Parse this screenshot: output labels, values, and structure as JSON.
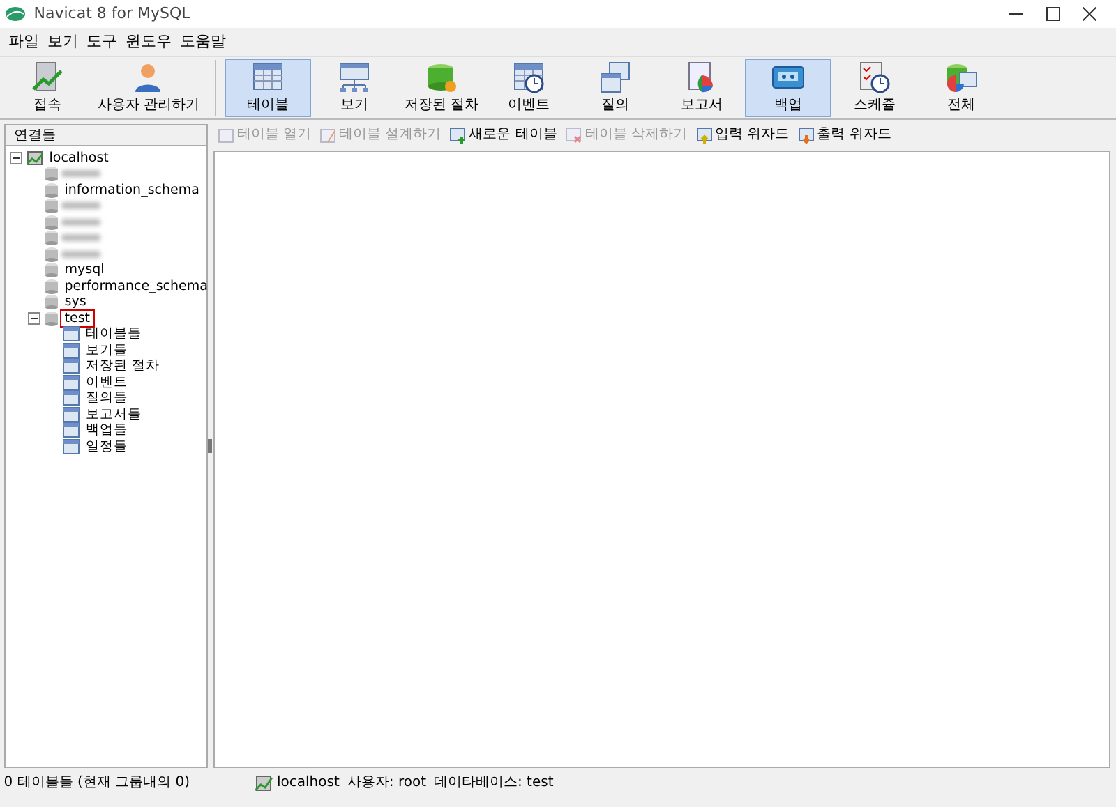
{
  "window": {
    "title": "Navicat 8 for MySQL"
  },
  "menu": [
    {
      "label": "파일"
    },
    {
      "label": "보기"
    },
    {
      "label": "도구"
    },
    {
      "label": "윈도우"
    },
    {
      "label": "도움말"
    }
  ],
  "toolbar": [
    {
      "label": "접속",
      "selected": false,
      "separator_after": false
    },
    {
      "label": "사용자 관리하기",
      "selected": false,
      "separator_after": true
    },
    {
      "label": "테이블",
      "selected": true,
      "separator_after": false
    },
    {
      "label": "보기",
      "selected": false,
      "separator_after": false
    },
    {
      "label": "저장된 절차",
      "selected": false,
      "separator_after": false
    },
    {
      "label": "이벤트",
      "selected": false,
      "separator_after": false
    },
    {
      "label": "질의",
      "selected": false,
      "separator_after": false
    },
    {
      "label": "보고서",
      "selected": false,
      "separator_after": false
    },
    {
      "label": "백업",
      "selected": true,
      "separator_after": false
    },
    {
      "label": "스케쥴",
      "selected": false,
      "separator_after": false
    },
    {
      "label": "전체",
      "selected": false,
      "separator_after": false
    }
  ],
  "sidebar": {
    "title": "연결들",
    "tree": [
      {
        "label": "localhost",
        "kind": "connection",
        "expanded": true,
        "selected": false,
        "children": [
          {
            "kind": "blurred"
          },
          {
            "label": "information_schema",
            "kind": "database",
            "selected": false
          },
          {
            "kind": "blurred"
          },
          {
            "kind": "blurred"
          },
          {
            "kind": "blurred"
          },
          {
            "kind": "blurred"
          },
          {
            "label": "mysql",
            "kind": "database",
            "selected": false
          },
          {
            "label": "performance_schema",
            "kind": "database",
            "selected": false
          },
          {
            "label": "sys",
            "kind": "database",
            "selected": false
          },
          {
            "label": "test",
            "kind": "database",
            "expanded": true,
            "selected": true,
            "children": [
              {
                "label": "테이블들",
                "kind": "object",
                "selected": false
              },
              {
                "label": "보기들",
                "kind": "object",
                "selected": false
              },
              {
                "label": "저장된 절차",
                "kind": "object",
                "selected": false
              },
              {
                "label": "이벤트",
                "kind": "object",
                "selected": false
              },
              {
                "label": "질의들",
                "kind": "object",
                "selected": false
              },
              {
                "label": "보고서들",
                "kind": "object",
                "selected": false
              },
              {
                "label": "백업들",
                "kind": "object",
                "selected": false
              },
              {
                "label": "일정들",
                "kind": "object",
                "selected": false
              }
            ]
          }
        ]
      }
    ]
  },
  "actions": [
    {
      "label": "테이블 열기",
      "disabled": true
    },
    {
      "label": "테이블 설계하기",
      "disabled": true
    },
    {
      "label": "새로운 테이블",
      "disabled": false
    },
    {
      "label": "테이블 삭제하기",
      "disabled": true
    },
    {
      "label": "입력 위자드",
      "disabled": false
    },
    {
      "label": "출력 위자드",
      "disabled": false
    }
  ],
  "status_bar": {
    "summary": "0 테이블들 (현재 그룹내의 0)",
    "connection": "localhost",
    "user": "사용자: root",
    "database": "데이타베이스: test"
  }
}
